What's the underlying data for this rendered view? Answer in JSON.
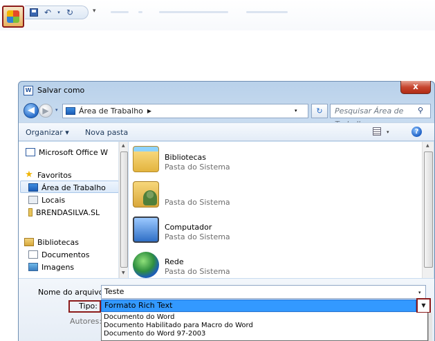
{
  "dialog": {
    "title": "Salvar como",
    "close_label": "x",
    "address": "Área de Trabalho",
    "search_placeholder": "Pesquisar Área de Trabalho"
  },
  "toolbar": {
    "organize": "Organizar ▾",
    "new_folder": "Nova pasta",
    "help": "?"
  },
  "nav": {
    "items": [
      {
        "label": "Microsoft Office W",
        "icon": "word-doc-icon"
      },
      {
        "label": "Favoritos",
        "icon": "star-icon"
      },
      {
        "label": "Área de Trabalho",
        "icon": "desktop-icon"
      },
      {
        "label": "Locais",
        "icon": "recent-places-icon"
      },
      {
        "label": "BRENDASILVA.SL",
        "icon": "user-folder-icon"
      },
      {
        "label": "Bibliotecas",
        "icon": "libraries-icon"
      },
      {
        "label": "Documentos",
        "icon": "documents-icon"
      },
      {
        "label": "Imagens",
        "icon": "pictures-icon"
      }
    ]
  },
  "files": [
    {
      "name": "Bibliotecas",
      "sub": "Pasta do Sistema",
      "icon": "libraries-folder-icon"
    },
    {
      "name": "",
      "sub": "Pasta do Sistema",
      "icon": "user-folder-icon"
    },
    {
      "name": "Computador",
      "sub": "Pasta do Sistema",
      "icon": "computer-icon"
    },
    {
      "name": "Rede",
      "sub": "Pasta do Sistema",
      "icon": "network-icon"
    }
  ],
  "form": {
    "filename_label": "Nome do arquivo:",
    "filename_value": "Teste",
    "type_label": "Tipo:",
    "type_value": "Formato Rich Text",
    "authors_label": "Autores:",
    "type_options": [
      "Documento do Word",
      "Documento Habilitado para Macro do Word",
      "Documento do Word 97-2003"
    ]
  },
  "colors": {
    "highlight_box": "#8b1a1a",
    "selection_blue": "#3399ff"
  }
}
